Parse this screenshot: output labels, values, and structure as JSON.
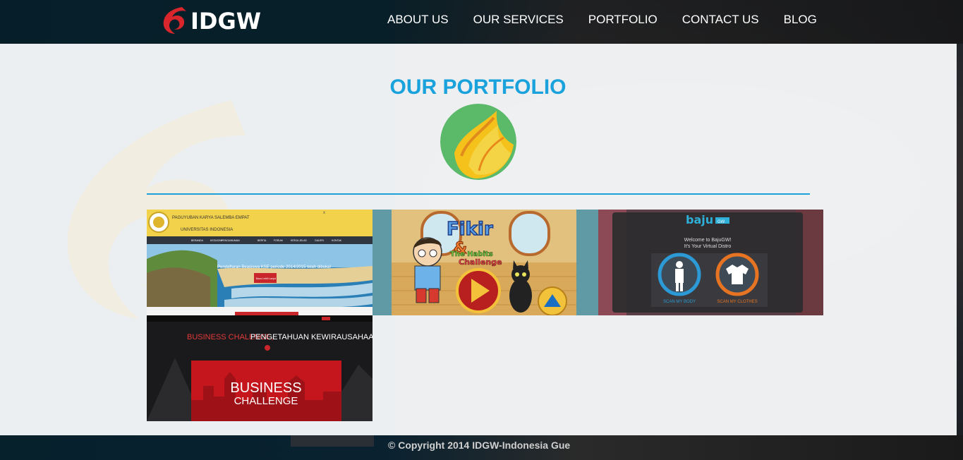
{
  "brand": {
    "name": "IDGW",
    "accent": "#19a2dc",
    "logo_red": "#d9262c"
  },
  "nav": {
    "items": [
      {
        "label": "ABOUT US"
      },
      {
        "label": "OUR SERVICES"
      },
      {
        "label": "PORTFOLIO"
      },
      {
        "label": "CONTACT US"
      },
      {
        "label": "BLOG"
      }
    ]
  },
  "portfolio": {
    "title": "OUR PORTFOLIO",
    "items": [
      {
        "header_title": "PAGUYUBAN KARYA SALEMBA EMPAT",
        "header_sub": "UNIVERSITAS INDONESIA",
        "menu": [
          "BERANDA",
          "KEGIATAN",
          "PENGUMUMAN",
          "BERITA",
          "FORUM",
          "KERJA JELAS",
          "GALERI",
          "KONTAK"
        ],
        "hero_text": "Pendaftaran Beasiswa KSE periode 2014/2015 telah dibuka!",
        "cta": "Baca Lebih Lanjut"
      },
      {
        "title_line1": "Fikir",
        "title_amp": "&",
        "title_line2": "The Habits",
        "title_line3": "Challenge"
      },
      {
        "logo": "baju",
        "logo_suffix": "GW",
        "welcome": "Welcome to BajuGW!",
        "tagline": "It's Your Virtual Distro",
        "scan_body": "SCAN MY BODY",
        "scan_clothes": "SCAN MY CLOTHES"
      },
      {
        "headline_red": "BUSINESS CHALENGE,",
        "headline_white": "PENGETAHUAN KEWIRAUSAHAAN",
        "banner_line1": "BUSINESS",
        "banner_line2": "CHALLENGE"
      }
    ]
  },
  "footer": {
    "copyright": "© Copyright 2014 IDGW-Indonesia Gue"
  }
}
